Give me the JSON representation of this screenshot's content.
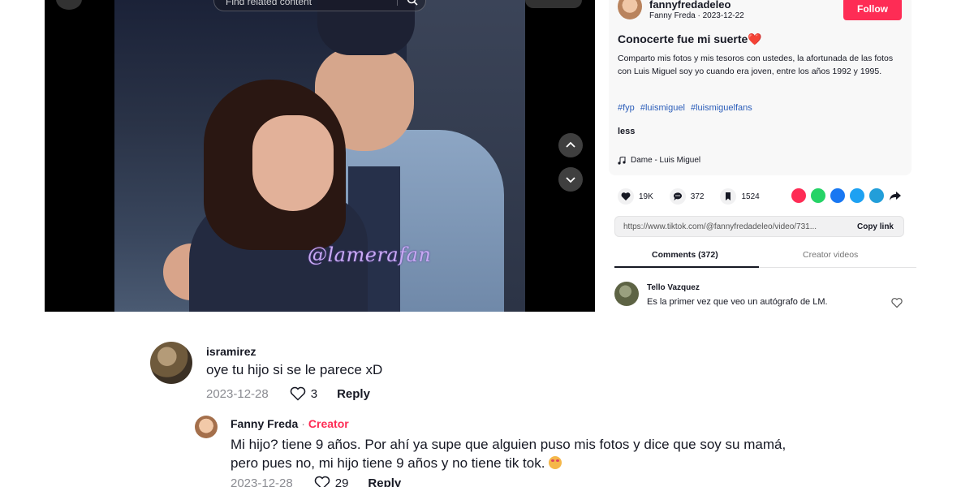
{
  "video": {
    "search_placeholder": "Find related content",
    "watermark": "@lamerafan",
    "icons": [
      "close-icon",
      "search-icon",
      "chevron-up-icon",
      "chevron-down-icon"
    ]
  },
  "post": {
    "username": "fannyfredadeleo",
    "display_name": "Fanny Freda",
    "date": "2023-12-22",
    "follow_label": "Follow",
    "title": "Conocerte fue mi suerte❤️",
    "description": "Comparto mis fotos y mis tesoros con ustedes, la afortunada de las fotos con Luis Miguel soy yo cuando era joven, entre los años 1992 y 1995.",
    "hashtags": [
      "#fyp",
      "#luismiguel",
      "#luismiguelfans"
    ],
    "less_label": "less",
    "music": "Dame - Luis Miguel",
    "stats": {
      "likes": "19K",
      "comments": "372",
      "saves": "1524"
    },
    "share_colors": [
      "#fe2c55",
      "#25d366",
      "#1877f2",
      "#1da1f2",
      "#229ed9"
    ],
    "link_url": "https://www.tiktok.com/@fannyfredadeleo/video/731...",
    "copy_link_label": "Copy link",
    "tabs": [
      "Comments (372)",
      "Creator videos"
    ],
    "top_comment": {
      "user": "Tello Vazquez",
      "text": "Es la primer vez que veo un autógrafo de LM."
    }
  },
  "thread": {
    "comment": {
      "user": "isramirez",
      "text": "oye tu hijo si se le parece xD",
      "date": "2023-12-28",
      "likes": "3",
      "reply_label": "Reply"
    },
    "reply": {
      "user": "Fanny Freda",
      "separator": "·",
      "badge": "Creator",
      "text_line1": "Mi hijo? tiene 9 años. Por ahí ya supe que alguien puso mis fotos y dice que soy su mamá,",
      "text_line2": "pero pues no, mi hijo tiene 9 años y no tiene tik tok.",
      "date": "2023-12-28",
      "likes": "29",
      "reply_label": "Reply"
    }
  }
}
